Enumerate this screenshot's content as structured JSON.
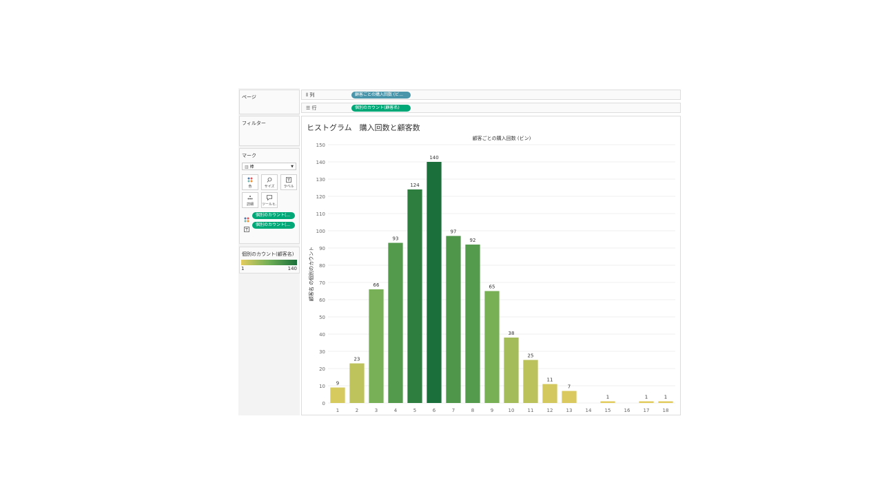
{
  "left_panel": {
    "pages_title": "ページ",
    "filters_title": "フィルター",
    "marks": {
      "title": "マーク",
      "type_label": "棒",
      "buttons": [
        {
          "label": "色",
          "icon": "color-dots-icon"
        },
        {
          "label": "サイズ",
          "icon": "size-icon"
        },
        {
          "label": "ラベル",
          "icon": "label-icon"
        },
        {
          "label": "詳細",
          "icon": "detail-icon"
        },
        {
          "label": "ツールヒ...",
          "icon": "tooltip-icon"
        }
      ],
      "fields": [
        {
          "label": "個別のカウント(...",
          "icon": "color-dots-icon"
        },
        {
          "label": "個別のカウント(...",
          "icon": "label-icon"
        }
      ]
    },
    "legend": {
      "title": "個別のカウント(顧客名)",
      "min_label": "1",
      "max_label": "140",
      "color_low": "#e3cc5f",
      "color_high": "#1a6f3a"
    }
  },
  "shelves": {
    "columns_label": "列",
    "columns_pill": "顧客ごとの購入回数 (ビ...",
    "columns_pill_color": "#4a95aa",
    "rows_label": "行",
    "rows_pill": "個別のカウント(顧客名)",
    "rows_pill_color": "#00a878"
  },
  "view_title": "ヒストグラム　購入回数と顧客数",
  "chart_data": {
    "type": "bar",
    "title": "顧客ごとの購入回数 (ビン)",
    "xlabel": "",
    "ylabel": "顧客名 の個別のカウント",
    "categories": [
      "1",
      "2",
      "3",
      "4",
      "5",
      "6",
      "7",
      "8",
      "9",
      "10",
      "11",
      "12",
      "13",
      "14",
      "15",
      "16",
      "17",
      "18"
    ],
    "values": [
      9,
      23,
      66,
      93,
      124,
      140,
      97,
      92,
      65,
      38,
      25,
      11,
      7,
      null,
      1,
      null,
      1,
      1
    ],
    "data_labels": [
      "9",
      "23",
      "66",
      "93",
      "124",
      "140",
      "97",
      "92",
      "65",
      "38",
      "25",
      "11",
      "7",
      "",
      "1",
      "",
      "1",
      "1"
    ],
    "ylim": [
      0,
      150
    ],
    "yticks": [
      0,
      10,
      20,
      30,
      40,
      50,
      60,
      70,
      80,
      90,
      100,
      110,
      120,
      130,
      140,
      150
    ],
    "grid": true,
    "color_scale": {
      "low": "#e3cc5f",
      "mid": "#6fae55",
      "high": "#1a6f3a",
      "min": 1,
      "max": 140
    }
  }
}
